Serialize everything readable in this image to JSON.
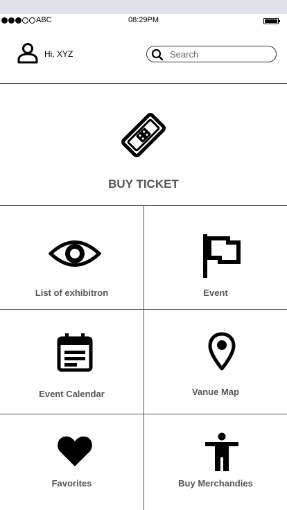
{
  "status_bar": {
    "carrier": "ABC",
    "time": "08:29PM"
  },
  "header": {
    "greeting": "Hi, XYZ",
    "search_placeholder": "Search"
  },
  "buy_ticket": {
    "label": "BUY TICKET",
    "icon": "ticket-icon"
  },
  "tiles": [
    {
      "label": "List  of exhibitron",
      "icon": "eye-icon"
    },
    {
      "label": "Event",
      "icon": "flag-icon"
    },
    {
      "label": "Event Calendar",
      "icon": "calendar-icon"
    },
    {
      "label": "Vanue Map",
      "icon": "map-pin-icon"
    },
    {
      "label": "Favorites",
      "icon": "heart-icon"
    },
    {
      "label": "Buy Merchandies",
      "icon": "person-icon"
    }
  ]
}
